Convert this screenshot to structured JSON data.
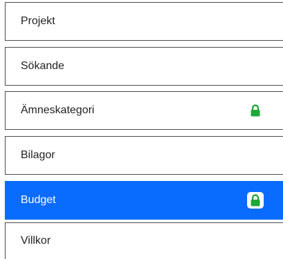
{
  "nav": {
    "items": [
      {
        "label": "Projekt",
        "locked": false,
        "active": false
      },
      {
        "label": "Sökande",
        "locked": false,
        "active": false
      },
      {
        "label": "Ämneskategori",
        "locked": true,
        "active": false
      },
      {
        "label": "Bilagor",
        "locked": false,
        "active": false
      },
      {
        "label": "Budget",
        "locked": true,
        "active": true
      },
      {
        "label": "Villkor",
        "locked": false,
        "active": false
      }
    ]
  },
  "colors": {
    "active_bg": "#0a6cff",
    "lock_green": "#1ea83a",
    "border": "#4a4a4a"
  },
  "icons": {
    "lock": "lock-icon"
  }
}
